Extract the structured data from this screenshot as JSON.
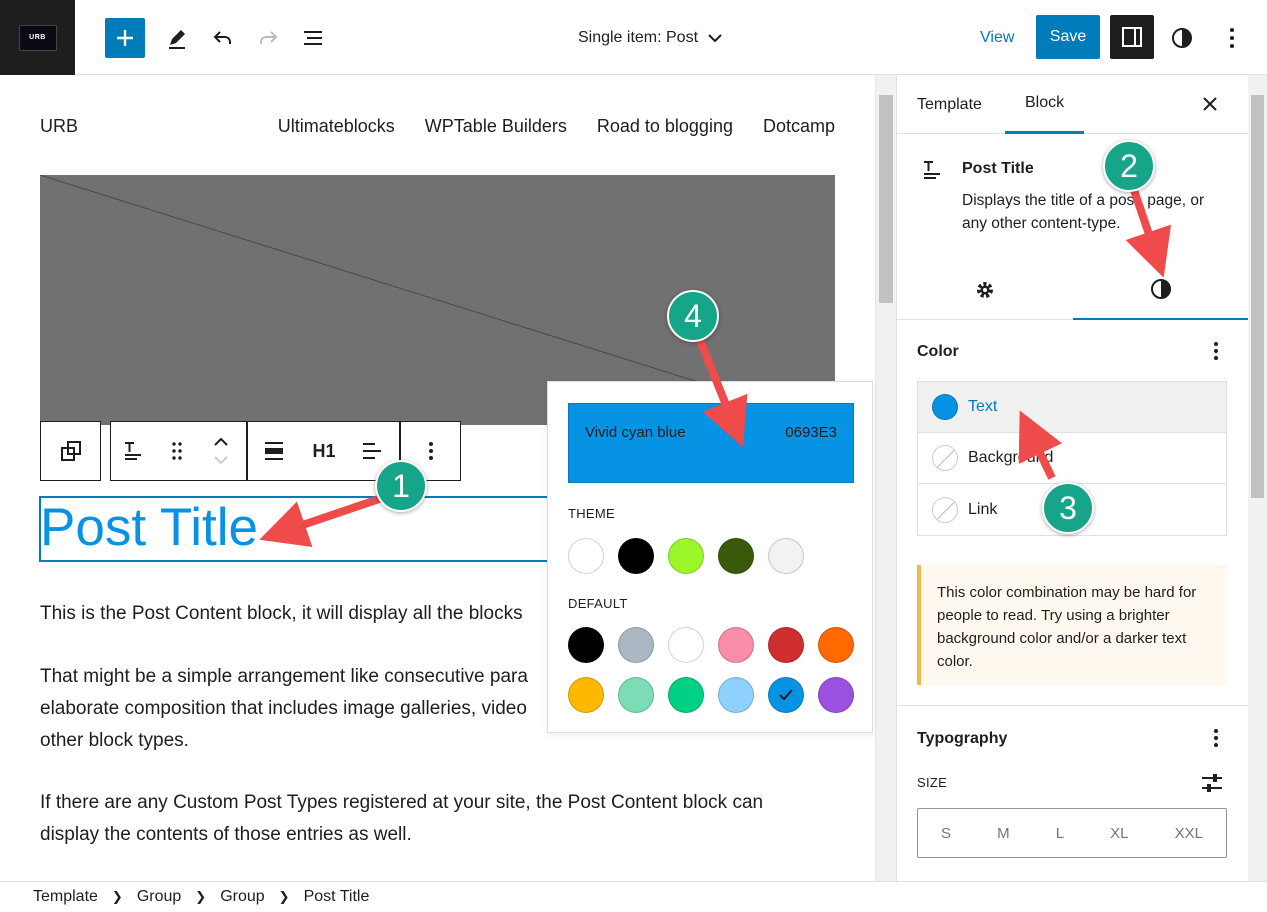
{
  "header": {
    "logo_text": "URB",
    "document_title": "Single item: Post",
    "view_label": "View",
    "save_label": "Save"
  },
  "canvas": {
    "site_title": "URB",
    "nav": [
      "Ultimateblocks",
      "WPTable Builders",
      "Road to blogging",
      "Dotcamp"
    ],
    "toolbar_heading_level": "H1",
    "post_title": "Post Title",
    "paragraphs": [
      "This is the Post Content block, it will display all the blocks",
      "That might be a simple arrangement like consecutive para",
      "elaborate composition that includes image galleries, video",
      "other block types.",
      "If there are any Custom Post Types registered at your site, the Post Content block can",
      "display the contents of those entries as well."
    ]
  },
  "color_popover": {
    "selected_name": "Vivid cyan blue",
    "selected_hex": "0693E3",
    "selected_color": "#0693e3",
    "theme_label": "THEME",
    "theme_colors": [
      "#ffffff",
      "#000000",
      "#9cf72a",
      "#3a5a0a",
      "#f2f2f2"
    ],
    "default_label": "DEFAULT",
    "default_colors": [
      "#000000",
      "#abb8c3",
      "#ffffff",
      "#f78da7",
      "#cf2e2e",
      "#ff6900",
      "#fcb900",
      "#7bdcb5",
      "#00d084",
      "#8ed1fc",
      "#0693e3",
      "#9b51e0"
    ]
  },
  "sidebar": {
    "tabs": [
      "Template",
      "Block"
    ],
    "block_name": "Post Title",
    "block_description": "Displays the title of a post, page, or any other content-type.",
    "color_panel": "Color",
    "color_items": [
      "Text",
      "Background",
      "Link"
    ],
    "notice": "This color combination may be hard for people to read. Try using a brighter background color and/or a darker text color.",
    "typography_panel": "Typography",
    "size_label": "SIZE",
    "sizes": [
      "S",
      "M",
      "L",
      "XL",
      "XXL"
    ]
  },
  "breadcrumbs": [
    "Template",
    "Group",
    "Group",
    "Post Title"
  ],
  "annotations": [
    "1",
    "2",
    "3",
    "4"
  ]
}
